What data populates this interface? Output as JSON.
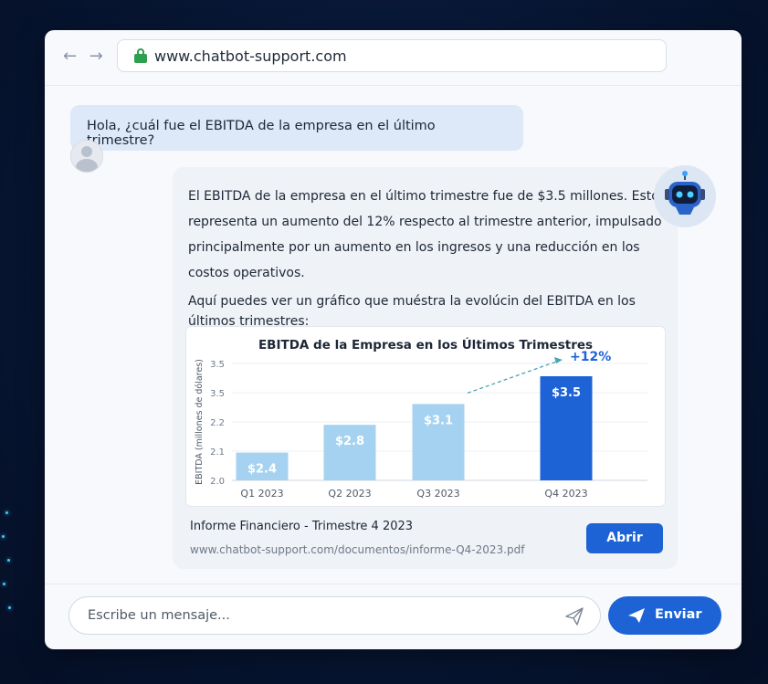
{
  "browser": {
    "nav_arrows": "← →",
    "url": "www.chatbot-support.com"
  },
  "user_message": "Hola, ¿cuál fue el EBITDA de la empresa en el último trimestre?",
  "bot": {
    "para1": "El EBITDA de la empresa en el último trimestre fue de $3.5 millones. Esto representa un aumento del 12% respecto al trimestre anterior, impulsado principalmente por un aumento en los ingresos y una reducción en los costos operativos.",
    "para2": "Aquí puedes ver un gráfico que muéstra la evolúcin del EBITDA en los últimos trimestres:",
    "document": {
      "title": "Informe Financiero - Trimestre 4 2023",
      "url": "www.chatbot-support.com/documentos/informe-Q4-2023.pdf",
      "open_label": "Abrir"
    }
  },
  "chart_data": {
    "type": "bar",
    "title": "EBITDA de la Empresa en los Últimos Trimestres",
    "ylabel": "EBITDA (millones de dólares)",
    "categories": [
      "Q1 2023",
      "Q2 2023",
      "Q3 2023",
      "Q4 2023"
    ],
    "values": [
      2.4,
      2.8,
      3.1,
      3.5
    ],
    "value_labels": [
      "$2.4",
      "$2.8",
      "$3.1",
      "$3.5"
    ],
    "y_tick_labels": [
      "2.0",
      "2.1",
      "2.2",
      "3.5",
      "3.5"
    ],
    "annotation": "+12%",
    "colors": [
      "#a5d2f1",
      "#a5d2f1",
      "#a5d2f1",
      "#1d63d6"
    ],
    "accent": "#1d63d6",
    "grid": true
  },
  "composer": {
    "placeholder": "Escribe un mensaje...",
    "send_label": "Enviar"
  }
}
